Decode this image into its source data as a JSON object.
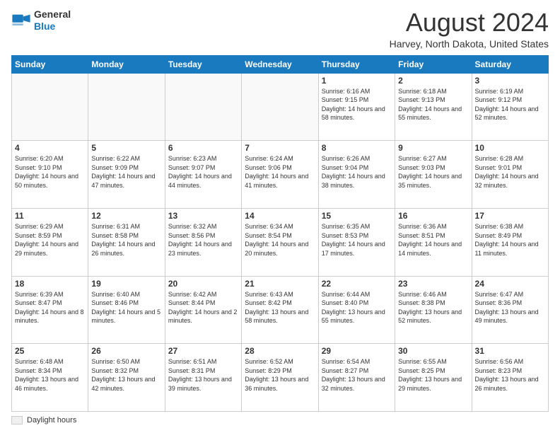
{
  "logo": {
    "general": "General",
    "blue": "Blue"
  },
  "title": "August 2024",
  "location": "Harvey, North Dakota, United States",
  "days_of_week": [
    "Sunday",
    "Monday",
    "Tuesday",
    "Wednesday",
    "Thursday",
    "Friday",
    "Saturday"
  ],
  "weeks": [
    [
      {
        "day": "",
        "info": ""
      },
      {
        "day": "",
        "info": ""
      },
      {
        "day": "",
        "info": ""
      },
      {
        "day": "",
        "info": ""
      },
      {
        "day": "1",
        "info": "Sunrise: 6:16 AM\nSunset: 9:15 PM\nDaylight: 14 hours and 58 minutes."
      },
      {
        "day": "2",
        "info": "Sunrise: 6:18 AM\nSunset: 9:13 PM\nDaylight: 14 hours and 55 minutes."
      },
      {
        "day": "3",
        "info": "Sunrise: 6:19 AM\nSunset: 9:12 PM\nDaylight: 14 hours and 52 minutes."
      }
    ],
    [
      {
        "day": "4",
        "info": "Sunrise: 6:20 AM\nSunset: 9:10 PM\nDaylight: 14 hours and 50 minutes."
      },
      {
        "day": "5",
        "info": "Sunrise: 6:22 AM\nSunset: 9:09 PM\nDaylight: 14 hours and 47 minutes."
      },
      {
        "day": "6",
        "info": "Sunrise: 6:23 AM\nSunset: 9:07 PM\nDaylight: 14 hours and 44 minutes."
      },
      {
        "day": "7",
        "info": "Sunrise: 6:24 AM\nSunset: 9:06 PM\nDaylight: 14 hours and 41 minutes."
      },
      {
        "day": "8",
        "info": "Sunrise: 6:26 AM\nSunset: 9:04 PM\nDaylight: 14 hours and 38 minutes."
      },
      {
        "day": "9",
        "info": "Sunrise: 6:27 AM\nSunset: 9:03 PM\nDaylight: 14 hours and 35 minutes."
      },
      {
        "day": "10",
        "info": "Sunrise: 6:28 AM\nSunset: 9:01 PM\nDaylight: 14 hours and 32 minutes."
      }
    ],
    [
      {
        "day": "11",
        "info": "Sunrise: 6:29 AM\nSunset: 8:59 PM\nDaylight: 14 hours and 29 minutes."
      },
      {
        "day": "12",
        "info": "Sunrise: 6:31 AM\nSunset: 8:58 PM\nDaylight: 14 hours and 26 minutes."
      },
      {
        "day": "13",
        "info": "Sunrise: 6:32 AM\nSunset: 8:56 PM\nDaylight: 14 hours and 23 minutes."
      },
      {
        "day": "14",
        "info": "Sunrise: 6:34 AM\nSunset: 8:54 PM\nDaylight: 14 hours and 20 minutes."
      },
      {
        "day": "15",
        "info": "Sunrise: 6:35 AM\nSunset: 8:53 PM\nDaylight: 14 hours and 17 minutes."
      },
      {
        "day": "16",
        "info": "Sunrise: 6:36 AM\nSunset: 8:51 PM\nDaylight: 14 hours and 14 minutes."
      },
      {
        "day": "17",
        "info": "Sunrise: 6:38 AM\nSunset: 8:49 PM\nDaylight: 14 hours and 11 minutes."
      }
    ],
    [
      {
        "day": "18",
        "info": "Sunrise: 6:39 AM\nSunset: 8:47 PM\nDaylight: 14 hours and 8 minutes."
      },
      {
        "day": "19",
        "info": "Sunrise: 6:40 AM\nSunset: 8:46 PM\nDaylight: 14 hours and 5 minutes."
      },
      {
        "day": "20",
        "info": "Sunrise: 6:42 AM\nSunset: 8:44 PM\nDaylight: 14 hours and 2 minutes."
      },
      {
        "day": "21",
        "info": "Sunrise: 6:43 AM\nSunset: 8:42 PM\nDaylight: 13 hours and 58 minutes."
      },
      {
        "day": "22",
        "info": "Sunrise: 6:44 AM\nSunset: 8:40 PM\nDaylight: 13 hours and 55 minutes."
      },
      {
        "day": "23",
        "info": "Sunrise: 6:46 AM\nSunset: 8:38 PM\nDaylight: 13 hours and 52 minutes."
      },
      {
        "day": "24",
        "info": "Sunrise: 6:47 AM\nSunset: 8:36 PM\nDaylight: 13 hours and 49 minutes."
      }
    ],
    [
      {
        "day": "25",
        "info": "Sunrise: 6:48 AM\nSunset: 8:34 PM\nDaylight: 13 hours and 46 minutes."
      },
      {
        "day": "26",
        "info": "Sunrise: 6:50 AM\nSunset: 8:32 PM\nDaylight: 13 hours and 42 minutes."
      },
      {
        "day": "27",
        "info": "Sunrise: 6:51 AM\nSunset: 8:31 PM\nDaylight: 13 hours and 39 minutes."
      },
      {
        "day": "28",
        "info": "Sunrise: 6:52 AM\nSunset: 8:29 PM\nDaylight: 13 hours and 36 minutes."
      },
      {
        "day": "29",
        "info": "Sunrise: 6:54 AM\nSunset: 8:27 PM\nDaylight: 13 hours and 32 minutes."
      },
      {
        "day": "30",
        "info": "Sunrise: 6:55 AM\nSunset: 8:25 PM\nDaylight: 13 hours and 29 minutes."
      },
      {
        "day": "31",
        "info": "Sunrise: 6:56 AM\nSunset: 8:23 PM\nDaylight: 13 hours and 26 minutes."
      }
    ]
  ],
  "legend": {
    "label": "Daylight hours"
  }
}
